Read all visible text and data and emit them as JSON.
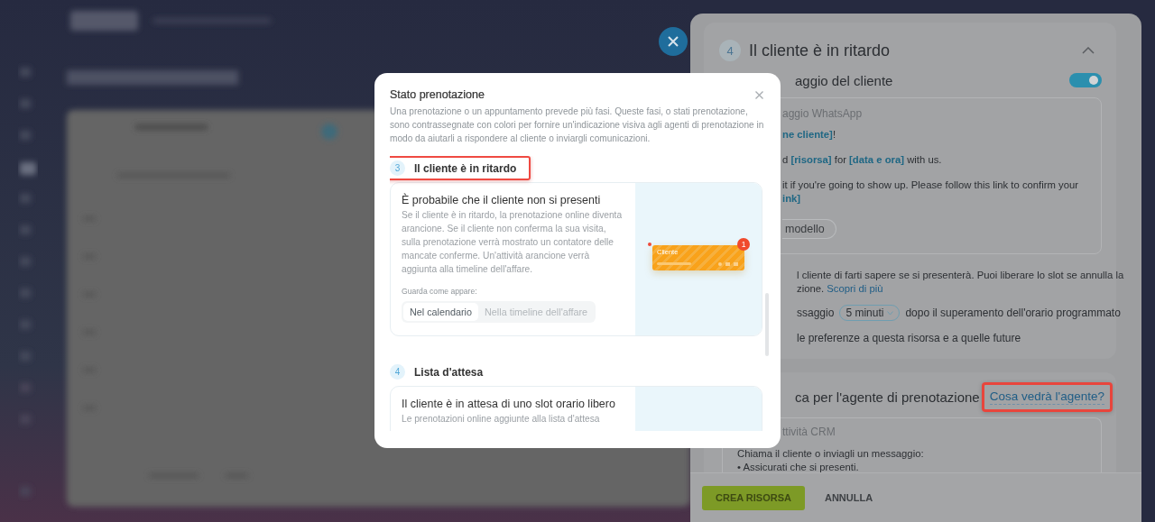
{
  "side_panel": {
    "step": "4",
    "title": "Il cliente è in ritardo",
    "expanded": true,
    "message_section": {
      "title": "aggio del cliente",
      "enabled": true,
      "box_label": "aggio WhatsApp",
      "lines": [
        "**ne cliente]**!",
        "d **[risorsa]** for **[data e ora]** with us.",
        "it if you're going to show up. Please follow this link to confirm your",
        "**ink]**"
      ],
      "template_button": "modello",
      "info_lines": [
        "l cliente di farti sapere se si presenterà. Puoi liberare lo slot se annulla la",
        "zione."
      ],
      "info_link": "Scopri di più",
      "delay_prefix": "ssaggio",
      "delay_value": "5 minuti",
      "delay_suffix": "dopo il superamento dell'orario programmato",
      "apply_text": "le preferenze a questa risorsa e a quelle future"
    },
    "agent_section": {
      "title": "ca per l'agente di prenotazione",
      "link": "Cosa vedrà l'agente?",
      "highlighted": true,
      "box_label": "ttività CRM",
      "lines": [
        "Chiama il cliente o inviagli un messaggio:",
        "• Assicurati che si presenti."
      ]
    },
    "footer_buttons": [
      {
        "label": "CREA RISORSA",
        "kind": "primary"
      },
      {
        "label": "ANNULLA",
        "kind": "link"
      }
    ]
  },
  "modal": {
    "title": "Stato prenotazione",
    "description": "Una prenotazione o un appuntamento prevede più fasi. Queste fasi, o stati prenotazione, sono contrassegnate con colori per fornire un'indicazione visiva agli agenti di prenotazione in modo da aiutarli a rispondere al cliente o inviargli comunicazioni.",
    "sections": [
      {
        "step": "3",
        "title": "Il cliente è in ritardo",
        "highlighted": true,
        "heading": "È probabile che il cliente non si presenti",
        "body": "Se il cliente è in ritardo, la prenotazione online diventa arancione. Se il cliente non conferma la sua visita, sulla prenotazione verrà mostrato un contatore delle mancate conferme. Un'attività arancione verrà aggiunta alla timeline dell'affare.",
        "preview_label": "Guarda come appare:",
        "views": [
          {
            "label": "Nel calendario",
            "selected": true
          },
          {
            "label": "Nella timeline dell'affare",
            "selected": false
          }
        ],
        "preview": {
          "name": "Cliente",
          "badge": "1"
        }
      },
      {
        "step": "4",
        "title": "Lista d'attesa",
        "highlighted": false,
        "heading": "Il cliente è in attesa di uno slot orario libero",
        "body": "Le prenotazioni online aggiunte alla lista d'attesa"
      }
    ]
  }
}
